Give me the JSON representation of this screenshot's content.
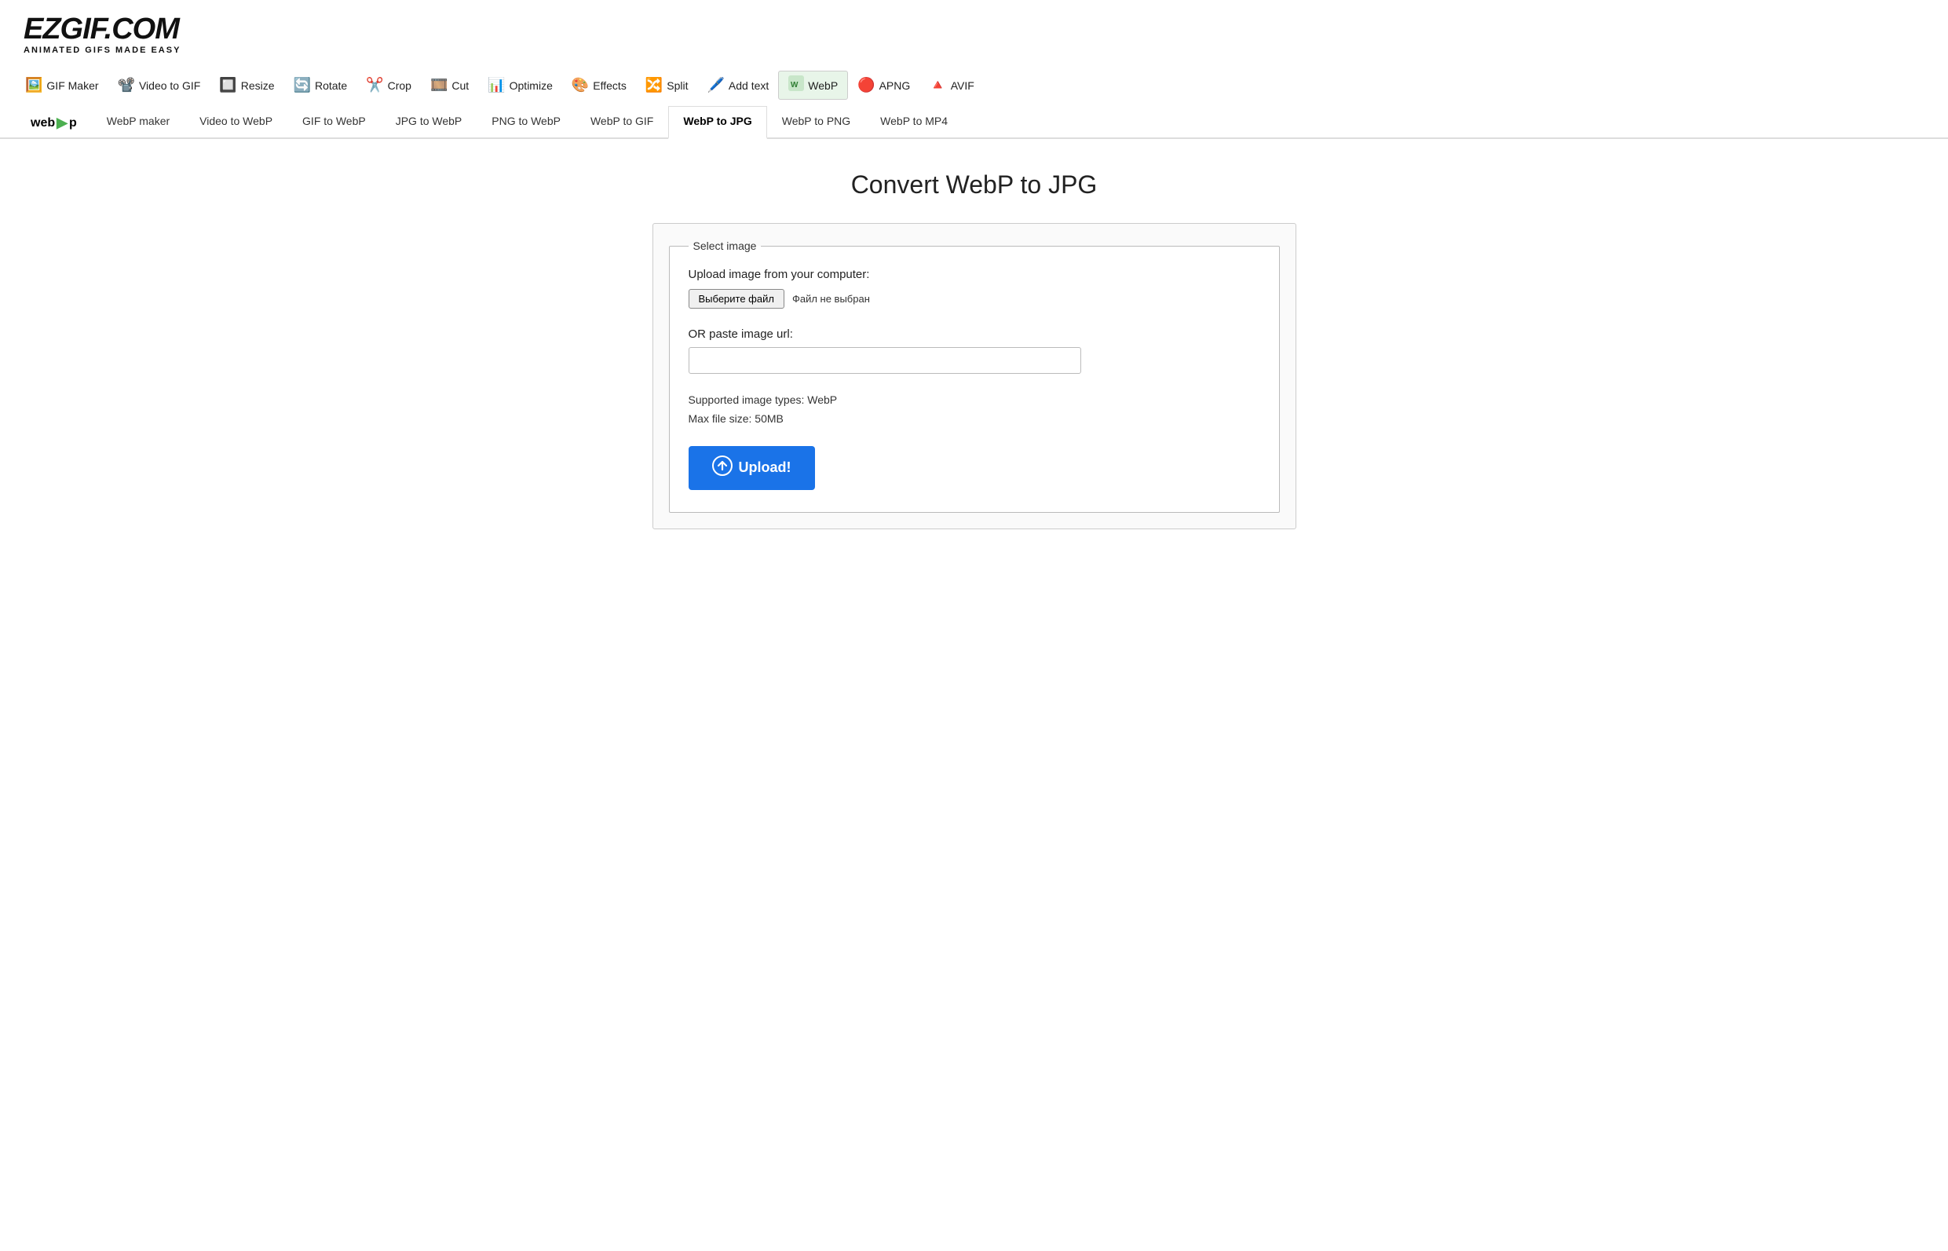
{
  "logo": {
    "title": "EZGIF.COM",
    "tagline": "ANIMATED GIFS MADE EASY"
  },
  "nav": {
    "items": [
      {
        "id": "gif-maker",
        "icon": "🖼️",
        "label": "GIF Maker"
      },
      {
        "id": "video-to-gif",
        "icon": "📽️",
        "label": "Video to GIF"
      },
      {
        "id": "resize",
        "icon": "🔲",
        "label": "Resize"
      },
      {
        "id": "rotate",
        "icon": "🔄",
        "label": "Rotate"
      },
      {
        "id": "crop",
        "icon": "✂️",
        "label": "Crop"
      },
      {
        "id": "cut",
        "icon": "🎞️",
        "label": "Cut"
      },
      {
        "id": "optimize",
        "icon": "📊",
        "label": "Optimize"
      },
      {
        "id": "effects",
        "icon": "🎨",
        "label": "Effects"
      },
      {
        "id": "split",
        "icon": "🔀",
        "label": "Split"
      },
      {
        "id": "add-text",
        "icon": "🖊️",
        "label": "Add text"
      },
      {
        "id": "webp",
        "icon": "🟩",
        "label": "WebP",
        "active": true
      },
      {
        "id": "apng",
        "icon": "🔴",
        "label": "APNG"
      },
      {
        "id": "avif",
        "icon": "🔺",
        "label": "AVIF"
      }
    ]
  },
  "subnav": {
    "logo_label": "webp",
    "logo_suffix": "p",
    "tabs": [
      {
        "id": "webp-maker",
        "label": "WebP maker",
        "active": false
      },
      {
        "id": "video-to-webp",
        "label": "Video to WebP",
        "active": false
      },
      {
        "id": "gif-to-webp",
        "label": "GIF to WebP",
        "active": false
      },
      {
        "id": "jpg-to-webp",
        "label": "JPG to WebP",
        "active": false
      },
      {
        "id": "png-to-webp",
        "label": "PNG to WebP",
        "active": false
      },
      {
        "id": "webp-to-gif",
        "label": "WebP to GIF",
        "active": false
      },
      {
        "id": "webp-to-jpg",
        "label": "WebP to JPG",
        "active": true
      },
      {
        "id": "webp-to-png",
        "label": "WebP to PNG",
        "active": false
      },
      {
        "id": "webp-to-mp4",
        "label": "WebP to MP4",
        "active": false
      }
    ]
  },
  "page": {
    "title": "Convert WebP to JPG",
    "fieldset_legend": "Select image",
    "upload_label": "Upload image from your computer:",
    "file_button_label": "Выберите файл",
    "file_no_selected": "Файл не выбран",
    "or_paste_label": "OR paste image url:",
    "url_placeholder": "",
    "supported_types": "Supported image types: WebP",
    "max_file_size": "Max file size: 50MB",
    "upload_button_label": "Upload!"
  }
}
